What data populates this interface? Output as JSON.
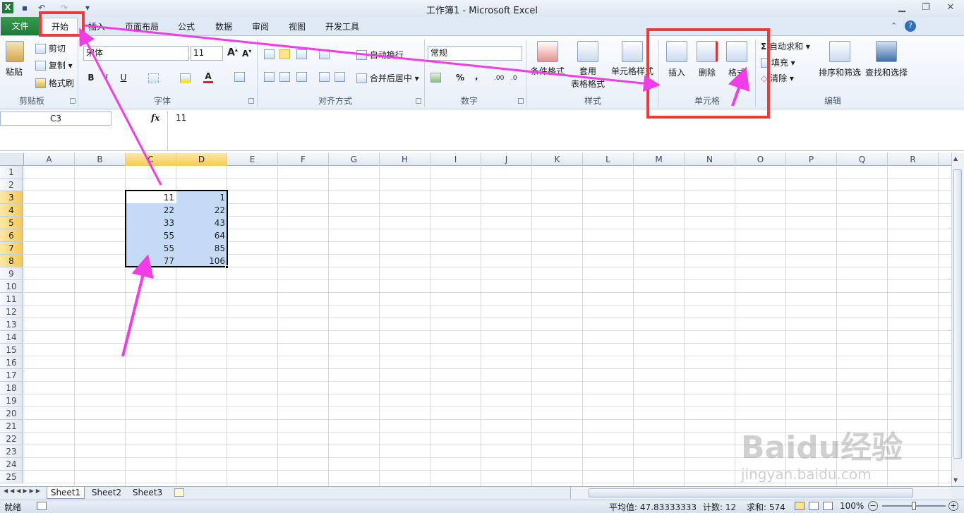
{
  "window": {
    "title": "工作簿1 - Microsoft Excel",
    "controls": [
      "▁",
      "❐",
      "✕"
    ]
  },
  "tabs": [
    "文件",
    "开始",
    "插入",
    "页面布局",
    "公式",
    "数据",
    "审阅",
    "视图",
    "开发工具"
  ],
  "ribbon": {
    "clipboard": {
      "paste": "粘贴",
      "cut": "剪切",
      "copy": "复制",
      "format_painter": "格式刷",
      "label": "剪贴板"
    },
    "font": {
      "name": "宋体",
      "size": "11",
      "label": "字体",
      "bold": "B",
      "italic": "I",
      "underline": "U"
    },
    "alignment": {
      "wrap": "自动换行",
      "merge": "合并后居中",
      "label": "对齐方式"
    },
    "number": {
      "format": "常规",
      "label": "数字",
      "percent": "%",
      "comma": ","
    },
    "styles": {
      "conditional": "条件格式",
      "table": "套用",
      "table2": "表格格式",
      "cell_styles": "单元格样式",
      "label": "样式"
    },
    "cells": {
      "insert": "插入",
      "delete": "删除",
      "format": "格式",
      "label": "单元格"
    },
    "editing": {
      "autosum": "自动求和",
      "fill": "填充",
      "clear": "清除",
      "sort": "排序和筛选",
      "find": "查找和选择",
      "label": "编辑"
    }
  },
  "formula_bar": {
    "name_box": "C3",
    "fx": "fx",
    "value": "11"
  },
  "columns": [
    "A",
    "B",
    "C",
    "D",
    "E",
    "F",
    "G",
    "H",
    "I",
    "J",
    "K",
    "L",
    "M",
    "N",
    "O",
    "P",
    "Q",
    "R"
  ],
  "rows": [
    "1",
    "2",
    "3",
    "4",
    "5",
    "6",
    "7",
    "8",
    "9",
    "10",
    "11",
    "12",
    "13",
    "14",
    "15",
    "16",
    "17",
    "18",
    "19",
    "20",
    "21",
    "22",
    "23",
    "24",
    "25"
  ],
  "cells": {
    "C": [
      "11",
      "22",
      "33",
      "55",
      "55",
      "77"
    ],
    "D": [
      "1",
      "22",
      "43",
      "64",
      "85",
      "106"
    ]
  },
  "sheets": [
    "Sheet1",
    "Sheet2",
    "Sheet3"
  ],
  "status": {
    "mode": "就绪",
    "average": "平均值: 47.83333333",
    "count": "计数: 12",
    "sum": "求和: 574",
    "zoom": "100%"
  },
  "watermark": {
    "brand": "Baidu经验",
    "url": "jingyan.baidu.com"
  },
  "colors": {
    "annotation_red": "#f03a3a",
    "arrow_magenta": "#f23ce8",
    "selection": "#c5dbf5",
    "file_tab": "#2a8a42"
  }
}
